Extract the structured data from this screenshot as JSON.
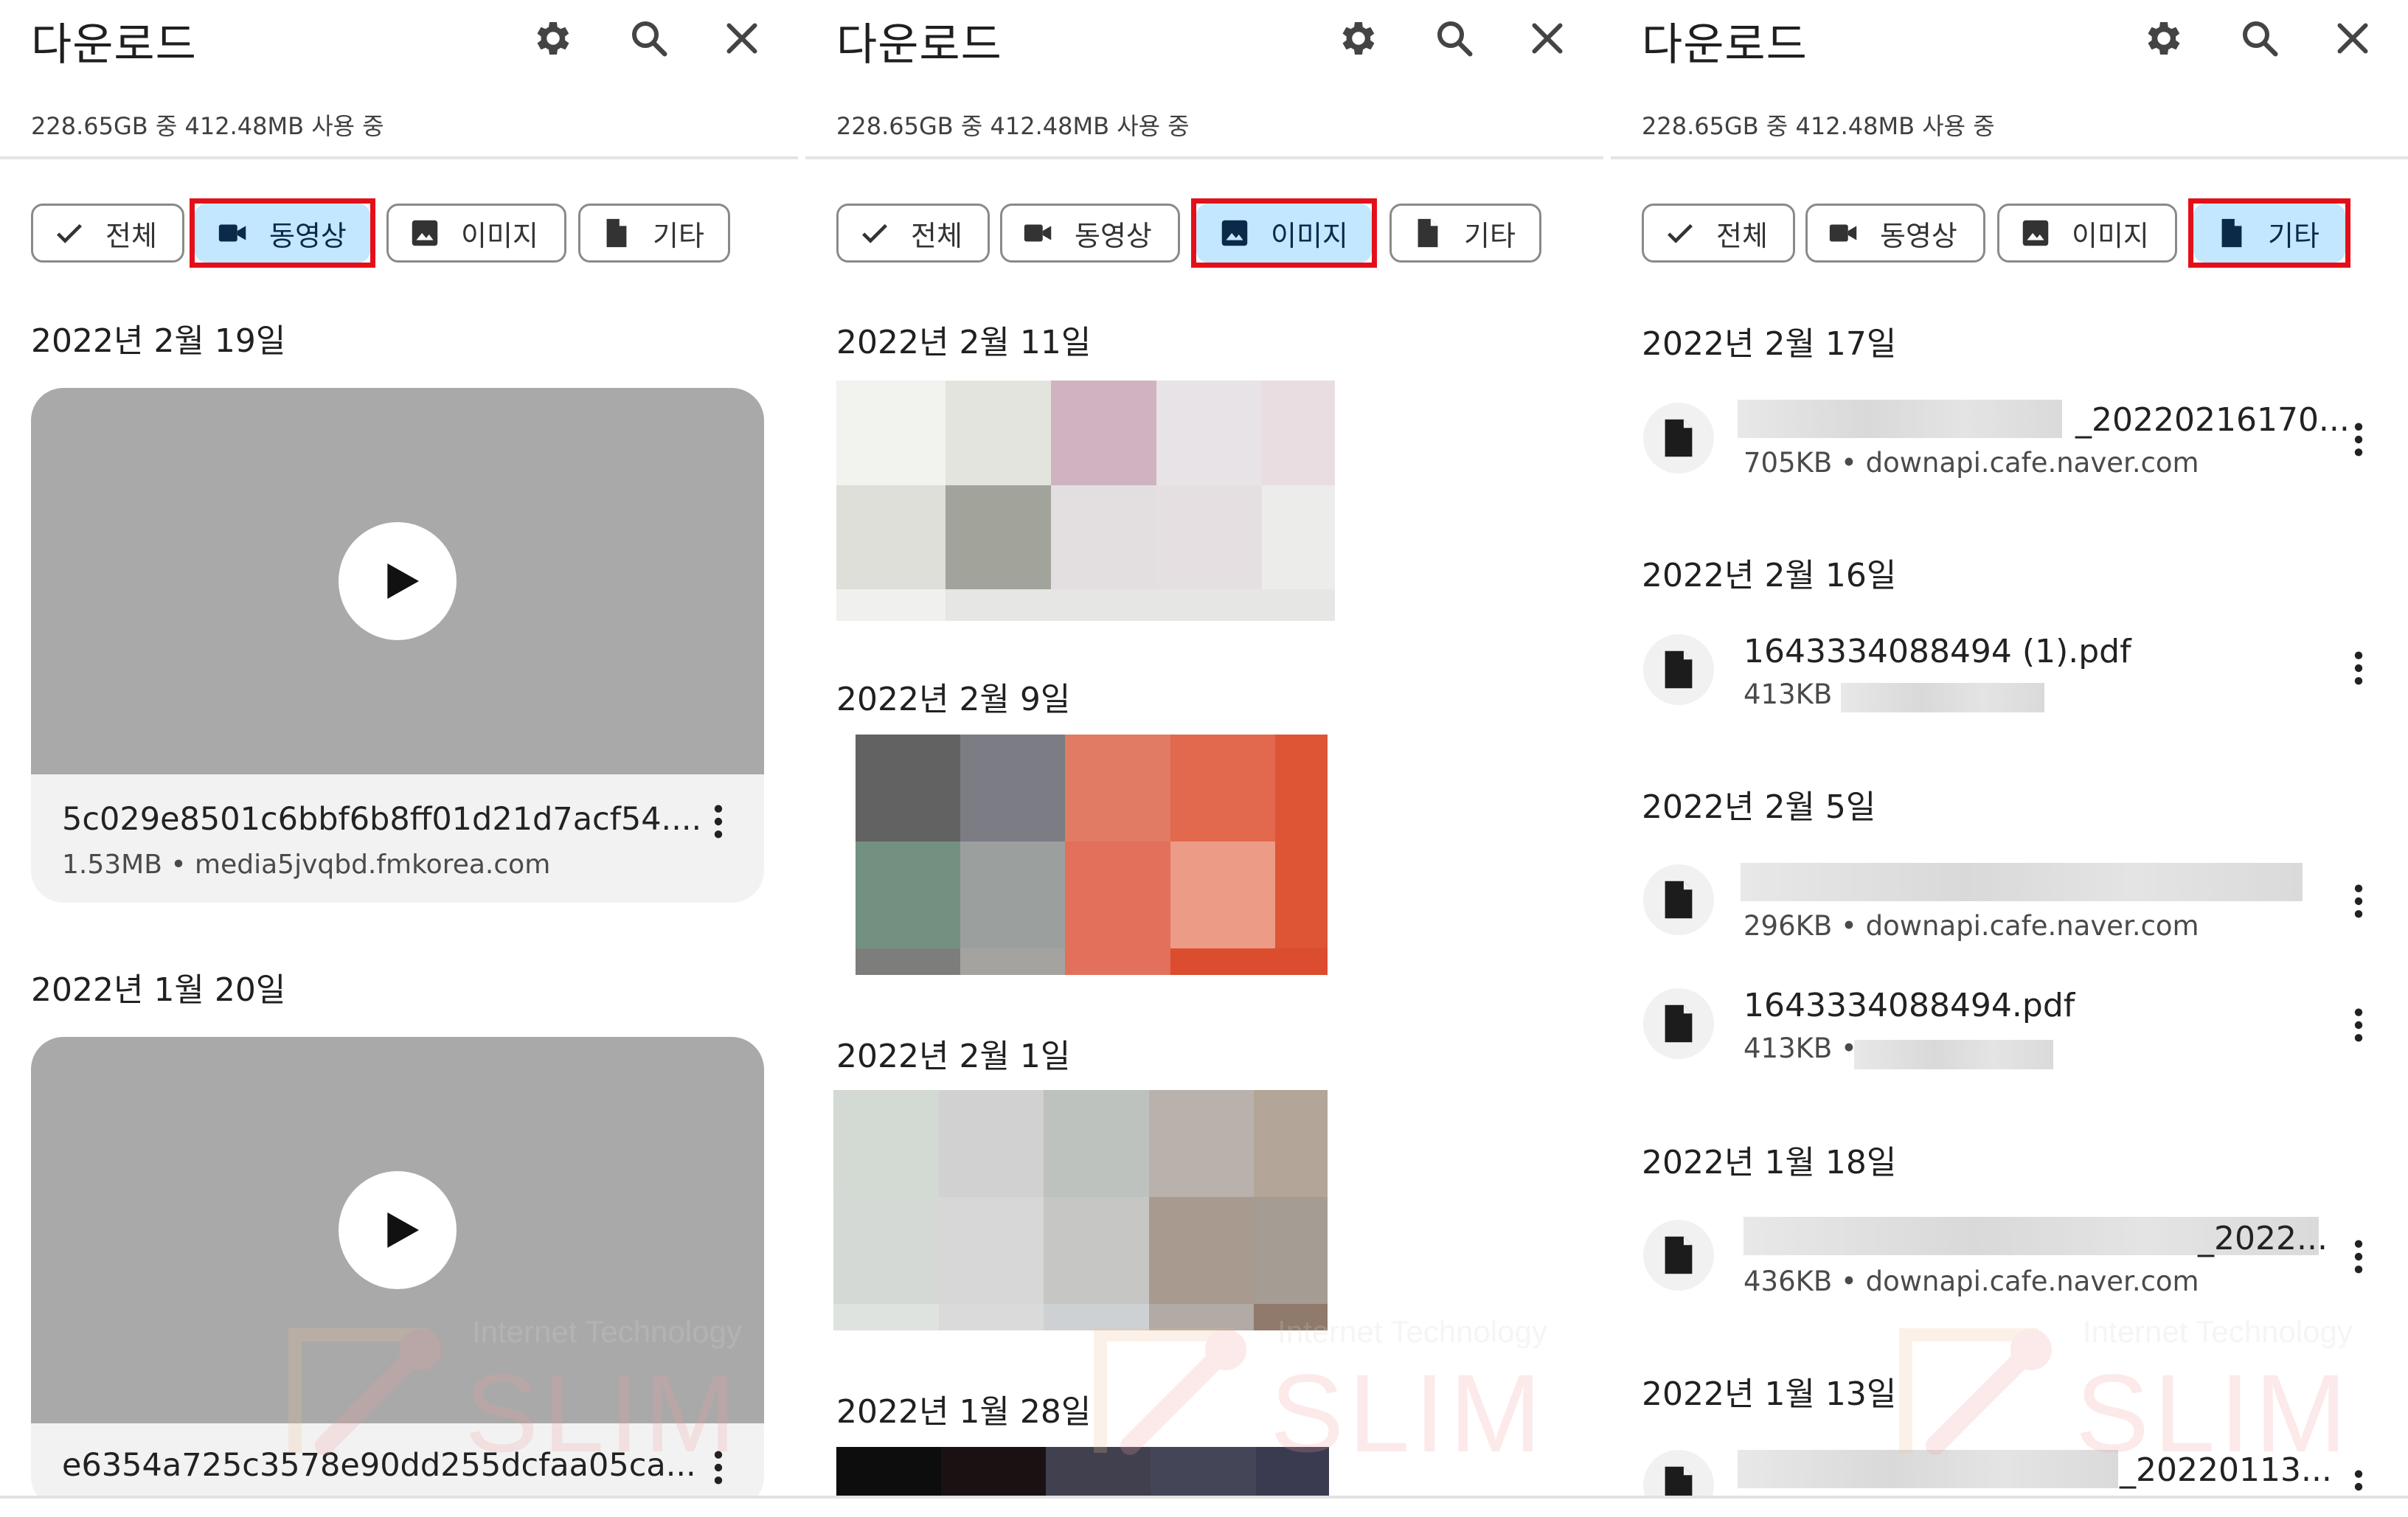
{
  "app": {
    "title": "다운로드",
    "storage": "228.65GB 중 412.48MB 사용 중"
  },
  "toolbar": {
    "icons": [
      "gear-icon",
      "search-icon",
      "close-icon"
    ]
  },
  "chips": {
    "all": "전체",
    "video": "동영상",
    "image": "이미지",
    "other": "기타"
  },
  "panels": {
    "video": {
      "active_chip": "video",
      "groups": [
        {
          "date": "2022년 2월 19일",
          "name": "5c029e8501c6bbf6b8ff01d21d7acf54....",
          "meta": "1.53MB • media5jvqbd.fmkorea.com"
        },
        {
          "date": "2022년 1월 20일",
          "name": "e6354a725c3578e90dd255dcfaa05ca..."
        }
      ]
    },
    "image": {
      "active_chip": "image",
      "groups": [
        {
          "date": "2022년 2월 11일"
        },
        {
          "date": "2022년 2월 9일"
        },
        {
          "date": "2022년 2월 1일"
        },
        {
          "date": "2022년 1월 28일"
        }
      ]
    },
    "other": {
      "active_chip": "other",
      "groups": [
        {
          "date": "2022년 2월 17일",
          "files": [
            {
              "name": "_20220216170...",
              "meta": "705KB • downapi.cafe.naver.com"
            }
          ]
        },
        {
          "date": "2022년 2월 16일",
          "files": [
            {
              "name": "1643334088494 (1).pdf",
              "meta": "413KB •"
            }
          ]
        },
        {
          "date": "2022년 2월 5일",
          "files": [
            {
              "name": "",
              "meta": "296KB • downapi.cafe.naver.com"
            },
            {
              "name": "1643334088494.pdf",
              "meta": "413KB •"
            }
          ]
        },
        {
          "date": "2022년 1월 18일",
          "files": [
            {
              "name": "_2022...",
              "meta": "436KB • downapi.cafe.naver.com"
            }
          ]
        },
        {
          "date": "2022년 1월 13일",
          "files": [
            {
              "name": "_20220113..."
            }
          ]
        }
      ]
    }
  },
  "watermark": {
    "logo": "SLIM",
    "tagline": "Internet Technology"
  },
  "colors": {
    "accent_chip": "#c2e7ff",
    "highlight_box": "#e3101a",
    "thumb_gray": "#a9a9a9"
  }
}
